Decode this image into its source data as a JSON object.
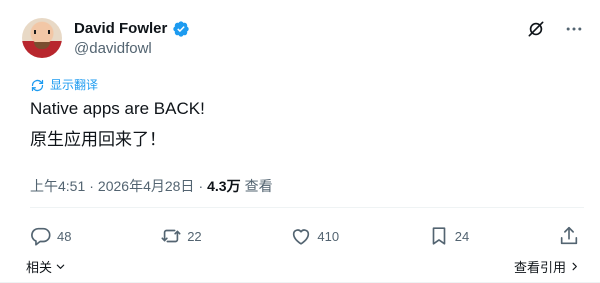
{
  "author": {
    "name": "David Fowler",
    "handle": "@davidfowl"
  },
  "translate_label": "显示翻译",
  "post": {
    "line1": "Native apps are BACK!",
    "line2": "原生应用回来了！"
  },
  "meta": {
    "time": "上午4:51",
    "separator1": "·",
    "date": "2026年4月28日",
    "separator2": "·",
    "views_count": "4.3万",
    "views_label": "查看"
  },
  "actions": {
    "reply_count": "48",
    "repost_count": "22",
    "like_count": "410",
    "bookmark_count": "24"
  },
  "bottom": {
    "related_label": "相关",
    "quotes_label": "查看引用"
  },
  "colors": {
    "accent": "#1d9bf0",
    "text_secondary": "#536471",
    "text_primary": "#0f1419"
  },
  "icons": {
    "verified": "verified-badge-icon",
    "grok": "grok-icon",
    "more": "more-options-icon",
    "translate": "translate-icon",
    "reply": "reply-icon",
    "repost": "repost-icon",
    "like": "heart-icon",
    "bookmark": "bookmark-icon",
    "share": "share-icon"
  }
}
